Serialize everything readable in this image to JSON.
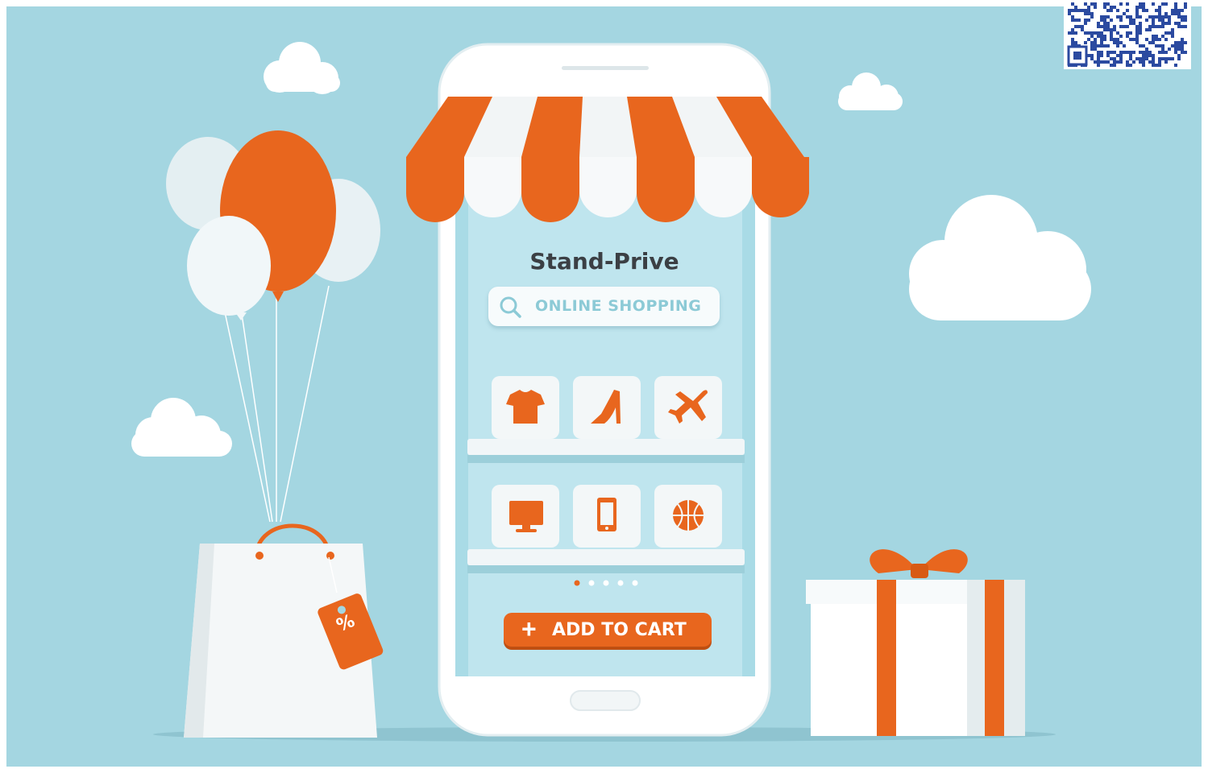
{
  "store": {
    "brand_name": "Stand-Prive",
    "search_label": "ONLINE SHOPPING",
    "cart_label": "ADD TO CART",
    "cart_plus": "+",
    "tag_text": "%"
  },
  "categories": [
    {
      "name": "t-shirt-icon"
    },
    {
      "name": "high-heel-icon"
    },
    {
      "name": "airplane-icon"
    },
    {
      "name": "monitor-icon"
    },
    {
      "name": "smartphone-icon"
    },
    {
      "name": "basketball-icon"
    }
  ],
  "carousel": {
    "count": 5,
    "active": 0
  },
  "colors": {
    "sky": "#a4d6e1",
    "accent": "#e8661e",
    "accent_dark": "#bf4f12",
    "white": "#ffffff",
    "screen": "#bfe5ee",
    "text_dark": "#3b3f44",
    "search_text": "#8ccad6"
  }
}
